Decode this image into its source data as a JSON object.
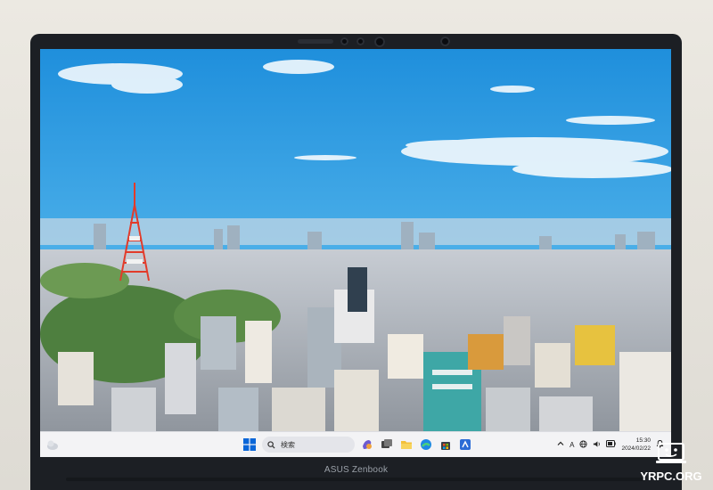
{
  "taskbar": {
    "search_placeholder": "検索",
    "clock_time": "15:30",
    "clock_date": "2024/02/22",
    "ime_indicator": "A",
    "accent_color": "#0a66d8"
  },
  "bezel": {
    "brand_text": "ASUS Zenbook"
  },
  "watermark": {
    "text": "YRPC.ORG"
  },
  "wallpaper": {
    "sky_color": "#3aa2e3",
    "tower_color": "#e23b2a"
  }
}
